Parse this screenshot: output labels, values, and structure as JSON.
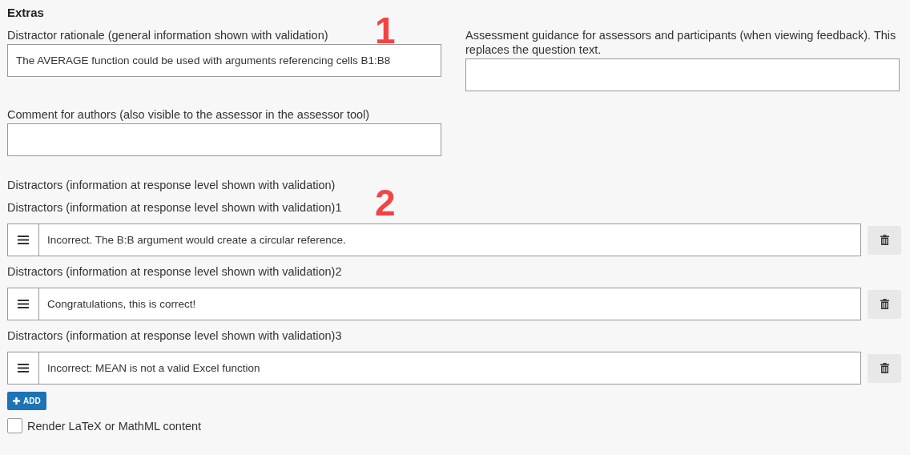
{
  "section_title": "Extras",
  "rationale": {
    "label": "Distractor rationale (general information shown with validation)",
    "value": "The AVERAGE function could be used with arguments referencing cells B1:B8"
  },
  "guidance": {
    "label": "Assessment guidance for assessors and participants (when viewing feedback). This replaces the question text."
  },
  "author_comment": {
    "label": "Comment for authors (also visible to the assessor in the assessor tool)"
  },
  "distractors_heading": "Distractors (information at response level shown with validation)",
  "distractors": [
    {
      "label": "Distractors (information at response level shown with validation)1",
      "value": "Incorrect. The B:B argument would create a circular reference."
    },
    {
      "label": "Distractors (information at response level shown with validation)2",
      "value": "Congratulations, this is correct!"
    },
    {
      "label": "Distractors (information at response level shown with validation)3",
      "value": "Incorrect: MEAN is not a valid Excel function"
    }
  ],
  "add_button": "ADD",
  "render_option": {
    "label": "Render LaTeX or MathML content",
    "checked": false
  },
  "annotations": [
    "1",
    "2"
  ]
}
